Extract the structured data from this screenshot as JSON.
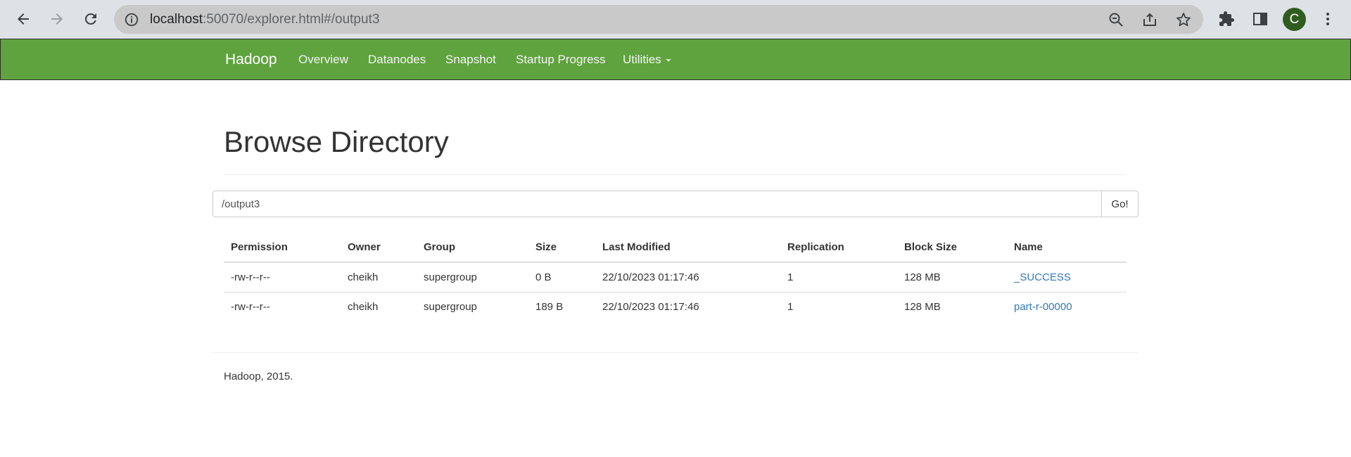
{
  "browser": {
    "url_host": "localhost",
    "url_path": ":50070/explorer.html#/output3",
    "avatar_letter": "C",
    "icons": [
      "back-icon",
      "forward-icon",
      "reload-icon",
      "info-icon",
      "zoom-out-icon",
      "share-icon",
      "star-icon",
      "extensions-icon",
      "side-panel-icon",
      "more-icon"
    ]
  },
  "navbar": {
    "brand": "Hadoop",
    "items": [
      "Overview",
      "Datanodes",
      "Snapshot",
      "Startup Progress",
      "Utilities"
    ],
    "color": "#5fa33e"
  },
  "main": {
    "title": "Browse Directory",
    "path_value": "/output3",
    "go_label": "Go!",
    "columns": [
      "Permission",
      "Owner",
      "Group",
      "Size",
      "Last Modified",
      "Replication",
      "Block Size",
      "Name"
    ],
    "rows": [
      {
        "permission": "-rw-r--r--",
        "owner": "cheikh",
        "group": "supergroup",
        "size": "0 B",
        "modified": "22/10/2023 01:17:46",
        "replication": "1",
        "block_size": "128 MB",
        "name": "_SUCCESS"
      },
      {
        "permission": "-rw-r--r--",
        "owner": "cheikh",
        "group": "supergroup",
        "size": "189 B",
        "modified": "22/10/2023 01:17:46",
        "replication": "1",
        "block_size": "128 MB",
        "name": "part-r-00000"
      }
    ]
  },
  "footer": {
    "text": "Hadoop, 2015."
  },
  "colors": {
    "link": "#337ab7",
    "chrome": "#dee1e6"
  }
}
